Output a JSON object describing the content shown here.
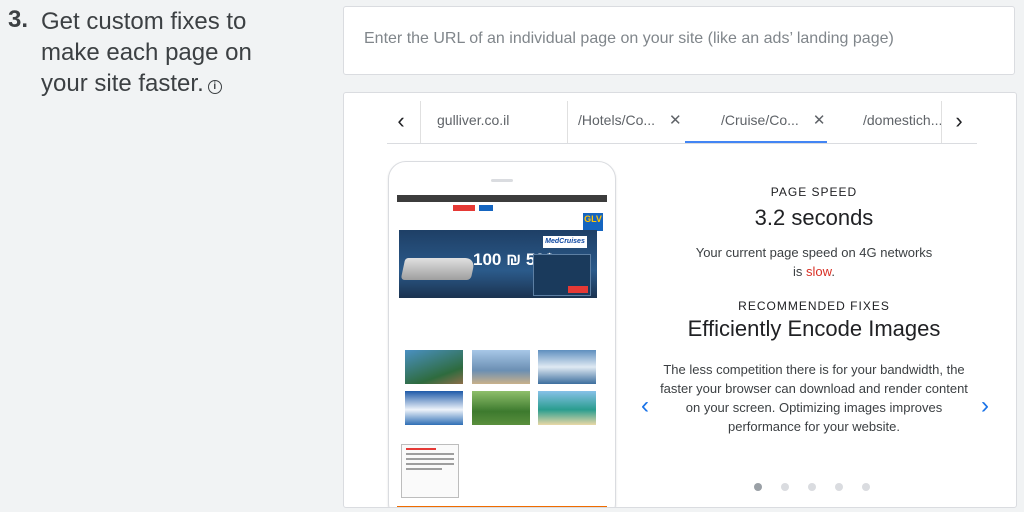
{
  "step": {
    "number": "3.",
    "lines": [
      "Get custom fixes to",
      "make each page on",
      "your site faster."
    ],
    "info_icon": "info-icon"
  },
  "url_input": {
    "value": "",
    "placeholder": "Enter the URL of an individual page on your site (like an ads’ landing page)"
  },
  "tabs": {
    "prev_icon": "chevron-left-icon",
    "next_icon": "chevron-right-icon",
    "items": [
      {
        "label": "gulliver.co.il",
        "closable": false,
        "active": false
      },
      {
        "label": "/Hotels/Co...",
        "closable": true,
        "active": false
      },
      {
        "label": "/Cruise/Co...",
        "closable": true,
        "active": true
      },
      {
        "label": "/domestich...",
        "closable": false,
        "active": false
      }
    ],
    "close_glyph": "✕"
  },
  "preview": {
    "logo": "GLV",
    "price": "100 ₪ 50$",
    "badge": "MedCruises"
  },
  "details": {
    "page_speed_label": "PAGE SPEED",
    "page_speed_value": "3.2 seconds",
    "speed_desc_line1": "Your current page speed on 4G networks",
    "speed_desc_prefix": "is",
    "speed_status": "slow",
    "speed_status_suffix": ".",
    "recommended_label": "RECOMMENDED FIXES",
    "fix_title": "Efficiently Encode Images",
    "fix_desc": "The less competition there is for your bandwidth, the faster your browser can download and render content on your screen. Optimizing images improves performance for your website.",
    "prev_icon": "chevron-left-icon",
    "next_icon": "chevron-right-icon",
    "dots_count": 5,
    "active_dot": 0
  },
  "colors": {
    "accent": "#1a73e8",
    "tab_indicator": "#4285f4",
    "slow": "#d93025",
    "footer_orange": "#ef6c00"
  }
}
